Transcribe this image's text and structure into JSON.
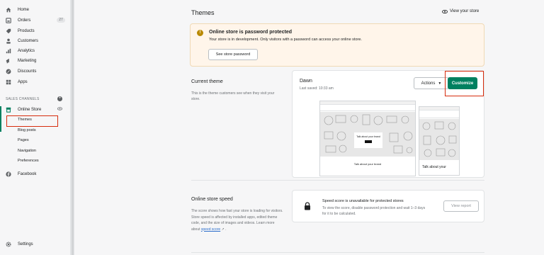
{
  "sidebar": {
    "items": [
      {
        "label": "Home",
        "icon": "home-icon"
      },
      {
        "label": "Orders",
        "icon": "orders-icon",
        "badge": "27"
      },
      {
        "label": "Products",
        "icon": "tag-icon"
      },
      {
        "label": "Customers",
        "icon": "person-icon"
      },
      {
        "label": "Analytics",
        "icon": "bar-chart-icon"
      },
      {
        "label": "Marketing",
        "icon": "megaphone-icon"
      },
      {
        "label": "Discounts",
        "icon": "discount-icon"
      },
      {
        "label": "Apps",
        "icon": "apps-icon"
      }
    ],
    "sales_channels_label": "SALES CHANNELS",
    "online_store": "Online Store",
    "sub_items": [
      "Themes",
      "Blog posts",
      "Pages",
      "Navigation",
      "Preferences"
    ],
    "facebook": "Facebook",
    "settings": "Settings"
  },
  "header": {
    "title": "Themes",
    "view_store": "View your store"
  },
  "banner": {
    "title": "Online store is password protected",
    "text": "Your store is in development. Only visitors with a password can access your online store.",
    "button": "See store password"
  },
  "current_theme": {
    "section_title": "Current theme",
    "section_desc": "This is the theme customers see when they visit your store.",
    "theme_name": "Dawn",
    "last_saved": "Last saved: 10:33 am",
    "actions_label": "Actions",
    "customize_label": "Customize",
    "preview_desktop_caption": "Talk about your brand",
    "preview_desktop_overlay": "Talk about your brand",
    "preview_mobile_caption": "Talk about your"
  },
  "speed": {
    "section_title": "Online store speed",
    "section_desc": "The score shows how fast your store is loading for visitors. Store speed is affected by installed apps, edited theme code, and the size of images and videos. Learn more about",
    "link": "speed score",
    "card_title": "Speed score is unavailable for protected stores",
    "card_text": "To view the score, disable password protection and wait 1–3 days for it to be calculated.",
    "button": "View report"
  },
  "colors": {
    "accent": "#008060",
    "highlight": "#d72c0d",
    "warning": "#b98900"
  }
}
